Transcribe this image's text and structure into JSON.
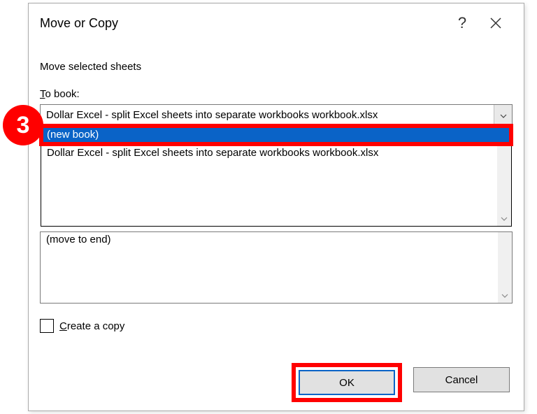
{
  "dialog": {
    "title": "Move or Copy",
    "help_icon": "?",
    "subtitle": "Move selected sheets",
    "to_book_label_pre": "T",
    "to_book_label_post": "o book:",
    "combo_selected": "Dollar Excel - split Excel sheets into separate workbooks workbook.xlsx",
    "dropdown": {
      "items": [
        "(new book)",
        "Dollar Excel - split Excel sheets into separate workbooks workbook.xlsx"
      ]
    },
    "lower_list_text": "(move to end)",
    "checkbox_pre": "C",
    "checkbox_post": "reate a copy",
    "ok_label": "OK",
    "cancel_label": "Cancel"
  },
  "annotation": {
    "step_number": "3"
  }
}
